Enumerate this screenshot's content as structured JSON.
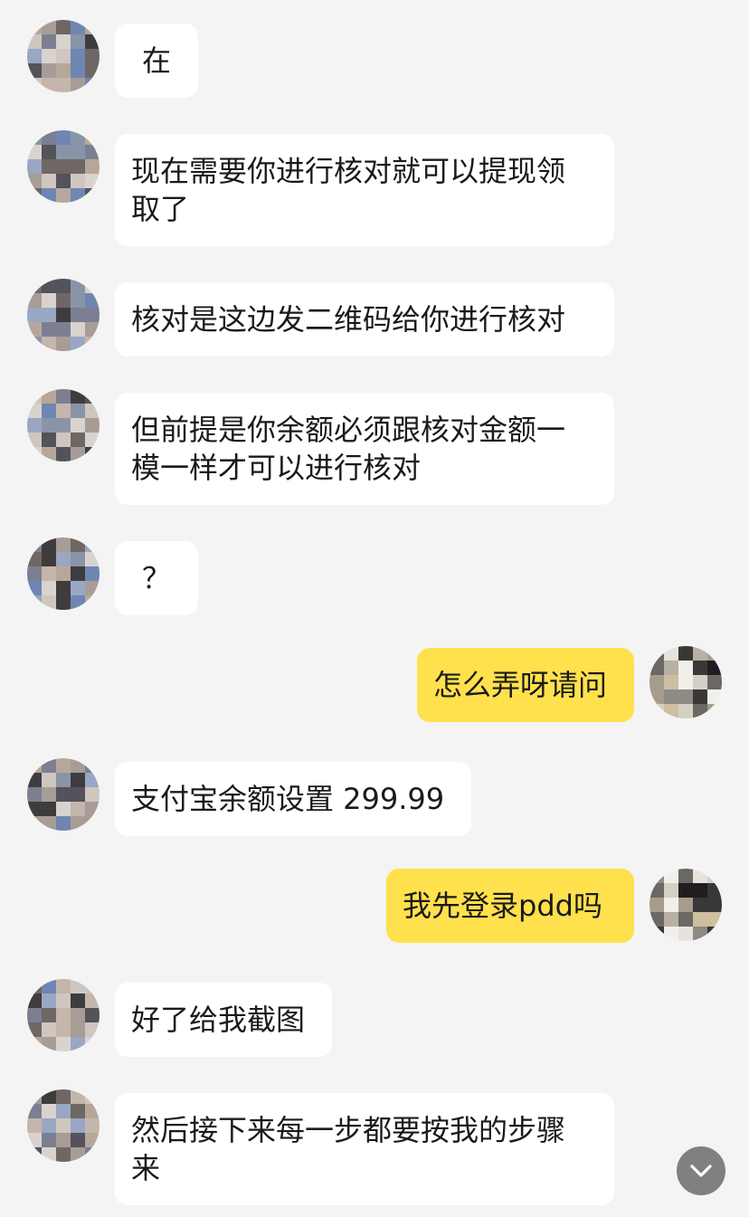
{
  "messages": [
    {
      "side": "in",
      "text": "在"
    },
    {
      "side": "in",
      "text": "现在需要你进行核对就可以提现领\n取了"
    },
    {
      "side": "in",
      "text": "核对是这边发二维码给你进行核对"
    },
    {
      "side": "in",
      "text": "但前提是你余额必须跟核对金额一\n模一样才可以进行核对"
    },
    {
      "side": "in",
      "text": "？"
    },
    {
      "side": "out",
      "text": "怎么弄呀请问"
    },
    {
      "side": "in",
      "text": "支付宝余额设置 299.99"
    },
    {
      "side": "out",
      "text": "我先登录pdd吗"
    },
    {
      "side": "in",
      "text": "好了给我截图"
    },
    {
      "side": "in",
      "text": "然后接下来每一步都要按我的步骤\n来"
    }
  ],
  "colors": {
    "background": "#f4f4f4",
    "incoming_bubble": "#ffffff",
    "outgoing_bubble": "#ffe14d",
    "text": "#1a1a1a"
  },
  "icons": {
    "scroll_down": "chevron-down-icon",
    "avatar_style": "pixelated-avatar"
  }
}
